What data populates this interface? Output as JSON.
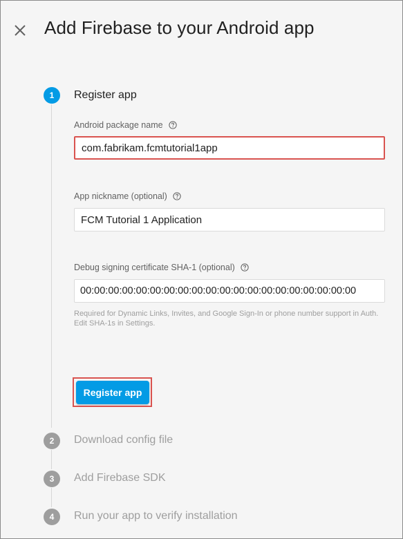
{
  "dialog": {
    "title": "Add Firebase to your Android app",
    "close_icon": "close-icon"
  },
  "steps": [
    {
      "number": "1",
      "label": "Register app",
      "state": "active"
    },
    {
      "number": "2",
      "label": "Download config file",
      "state": "inactive"
    },
    {
      "number": "3",
      "label": "Add Firebase SDK",
      "state": "inactive"
    },
    {
      "number": "4",
      "label": "Run your app to verify installation",
      "state": "inactive"
    }
  ],
  "form": {
    "package_name": {
      "label": "Android package name",
      "value": "com.fabrikam.fcmtutorial1app"
    },
    "nickname": {
      "label": "App nickname (optional)",
      "value": "FCM Tutorial 1 Application"
    },
    "sha1": {
      "label": "Debug signing certificate SHA-1 (optional)",
      "value": "00:00:00:00:00:00:00:00:00:00:00:00:00:00:00:00:00:00:00:00",
      "hint": "Required for Dynamic Links, Invites, and Google Sign-In or phone number support in Auth. Edit SHA-1s in Settings."
    },
    "submit_label": "Register app"
  },
  "colors": {
    "accent": "#039be5",
    "highlight": "#d9534f",
    "inactive": "#9e9e9e"
  }
}
